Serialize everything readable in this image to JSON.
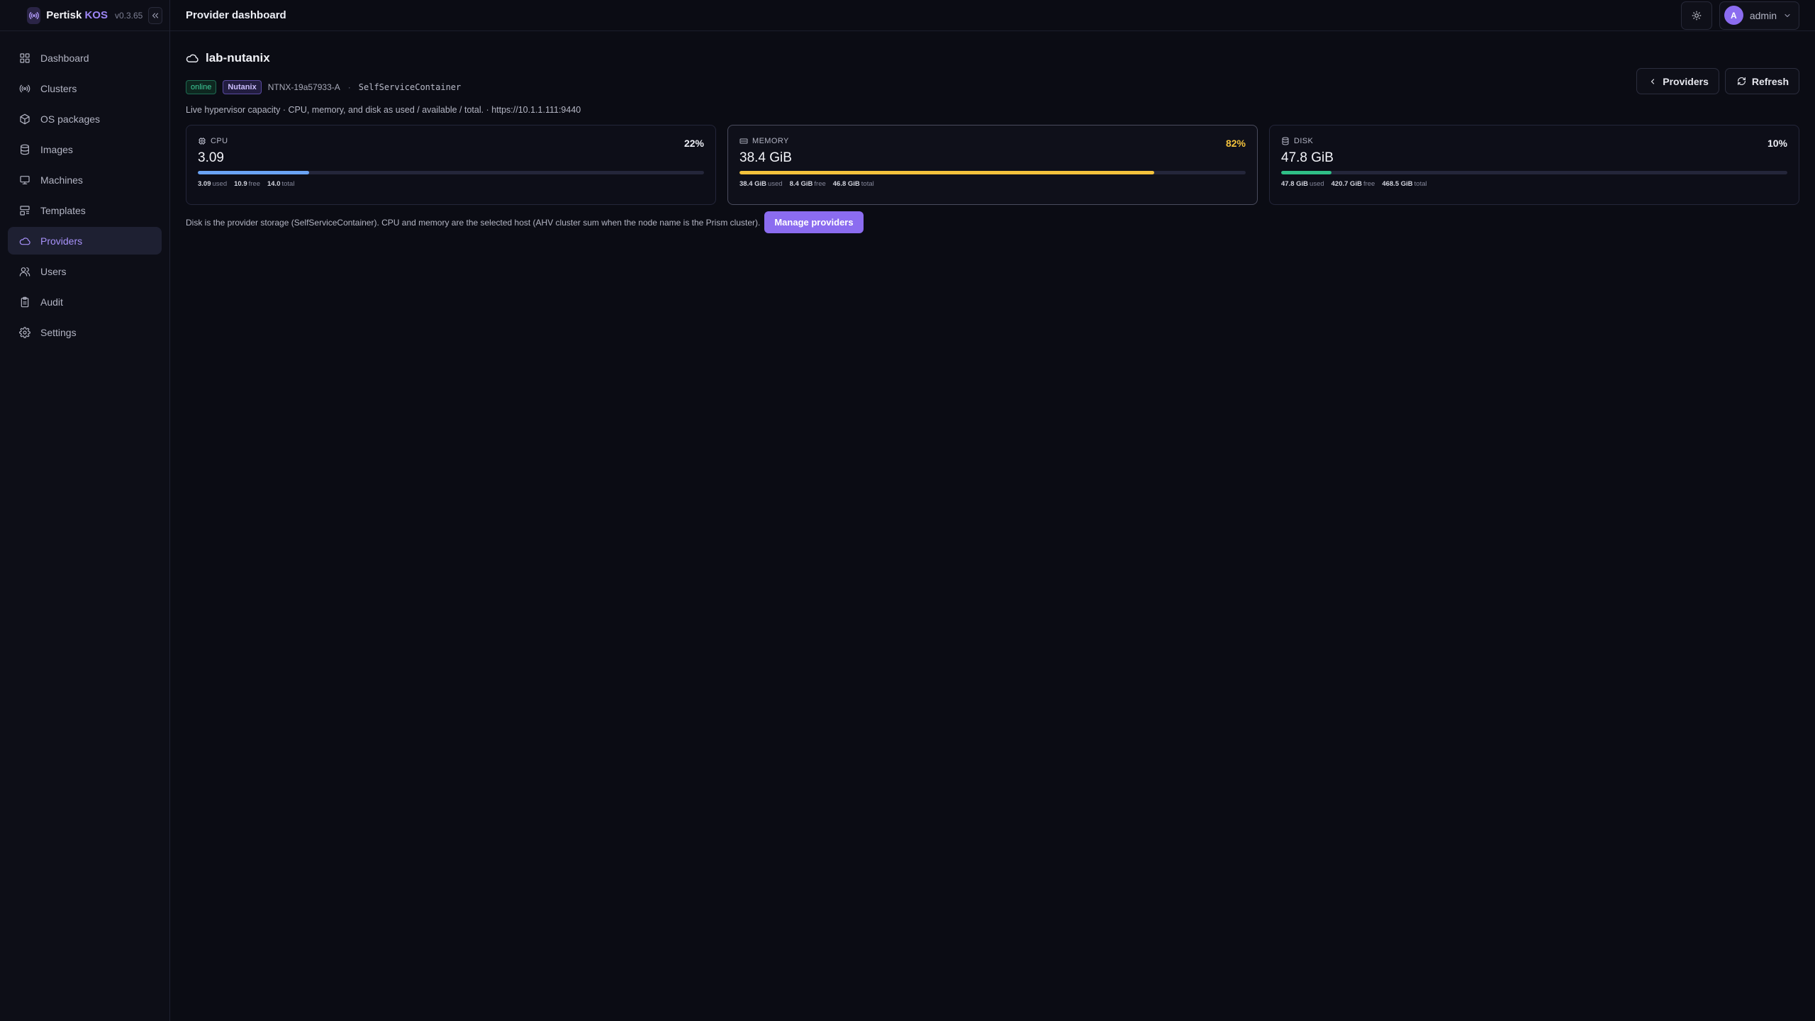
{
  "brand": {
    "name": "Pertisk",
    "accent": "KOS",
    "version": "v0.3.65"
  },
  "sidebar": {
    "items": [
      {
        "label": "Dashboard",
        "icon": "dashboard-icon"
      },
      {
        "label": "Clusters",
        "icon": "radio-icon"
      },
      {
        "label": "OS packages",
        "icon": "package-icon"
      },
      {
        "label": "Images",
        "icon": "database-icon"
      },
      {
        "label": "Machines",
        "icon": "monitor-icon"
      },
      {
        "label": "Templates",
        "icon": "template-icon"
      },
      {
        "label": "Providers",
        "icon": "cloud-icon",
        "active": true
      },
      {
        "label": "Users",
        "icon": "users-icon"
      },
      {
        "label": "Audit",
        "icon": "clipboard-icon"
      },
      {
        "label": "Settings",
        "icon": "gear-icon"
      }
    ]
  },
  "header": {
    "title": "Provider dashboard",
    "user": "admin",
    "avatar_letter": "A"
  },
  "provider": {
    "name": "lab-nutanix",
    "status": "online",
    "type": "Nutanix",
    "cluster_id": "NTNX-19a57933-A",
    "separator": "·",
    "storage": "SelfServiceContainer",
    "description": "Live hypervisor capacity · CPU, memory, and disk as used / available / total. · https://10.1.1.111:9440"
  },
  "actions": {
    "back_label": "Providers",
    "refresh_label": "Refresh",
    "manage_label": "Manage providers"
  },
  "cards": [
    {
      "label": "CPU",
      "icon": "cpu-icon",
      "percent": "22%",
      "percent_value": 22,
      "value": "3.09",
      "used": "3.09",
      "used_label": "used",
      "free": "10.9",
      "free_label": "free",
      "total": "14.0",
      "total_label": "total",
      "color": "#6aa3f5"
    },
    {
      "label": "MEMORY",
      "icon": "memory-icon",
      "percent": "82%",
      "percent_value": 82,
      "value": "38.4 GiB",
      "used": "38.4 GiB",
      "used_label": "used",
      "free": "8.4 GiB",
      "free_label": "free",
      "total": "46.8 GiB",
      "total_label": "total",
      "color": "#f3c23c"
    },
    {
      "label": "DISK",
      "icon": "disk-icon",
      "percent": "10%",
      "percent_value": 10,
      "value": "47.8 GiB",
      "used": "47.8 GiB",
      "used_label": "used",
      "free": "420.7 GiB",
      "free_label": "free",
      "total": "468.5 GiB",
      "total_label": "total",
      "color": "#2fbf86"
    }
  ],
  "footer_note": "Disk is the provider storage (SelfServiceContainer). CPU and memory are the selected host (AHV cluster sum when the node name is the Prism cluster)."
}
